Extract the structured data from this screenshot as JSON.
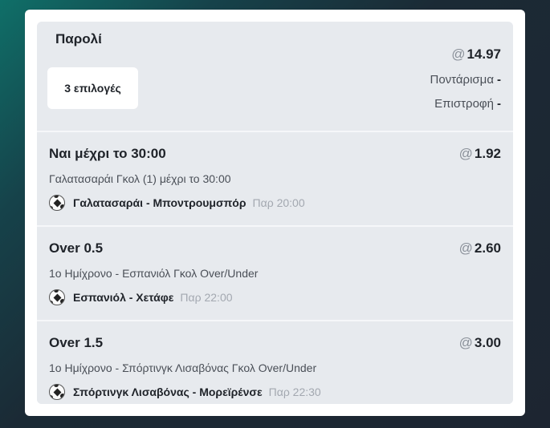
{
  "betslip": {
    "title": "Παρολί",
    "selections_count_label": "3 επιλογές",
    "total_odds_prefix": "@",
    "total_odds": "14.97",
    "stake_label": "Ποντάρισμα",
    "stake_value": "-",
    "return_label": "Επιστροφή",
    "return_value": "-"
  },
  "selections": [
    {
      "name": "Ναι μέχρι το 30:00",
      "odds_prefix": "@",
      "odds": "1.92",
      "market": "Γαλατασαράι Γκολ (1) μέχρι το 30:00",
      "event": "Γαλατασαράι - Μποντρουμσπόρ",
      "time": "Παρ 20:00",
      "sport_icon": "soccer-ball-icon"
    },
    {
      "name": "Over 0.5",
      "odds_prefix": "@",
      "odds": "2.60",
      "market": "1ο Ημίχρονο - Εσπανιόλ Γκολ Over/Under",
      "event": "Εσπανιόλ - Χετάφε",
      "time": "Παρ 22:00",
      "sport_icon": "soccer-ball-icon"
    },
    {
      "name": "Over 1.5",
      "odds_prefix": "@",
      "odds": "3.00",
      "market": "1ο Ημίχρονο - Σπόρτινγκ Λισαβόνας Γκολ Over/Under",
      "event": "Σπόρτινγκ Λισαβόνας - Μορεϊρένσε",
      "time": "Παρ 22:30",
      "sport_icon": "soccer-ball-icon"
    }
  ],
  "colors": {
    "card_bg": "#ffffff",
    "panel_bg": "#e7eaee",
    "text_primary": "#1f2329",
    "text_muted": "#a3a8b0"
  }
}
